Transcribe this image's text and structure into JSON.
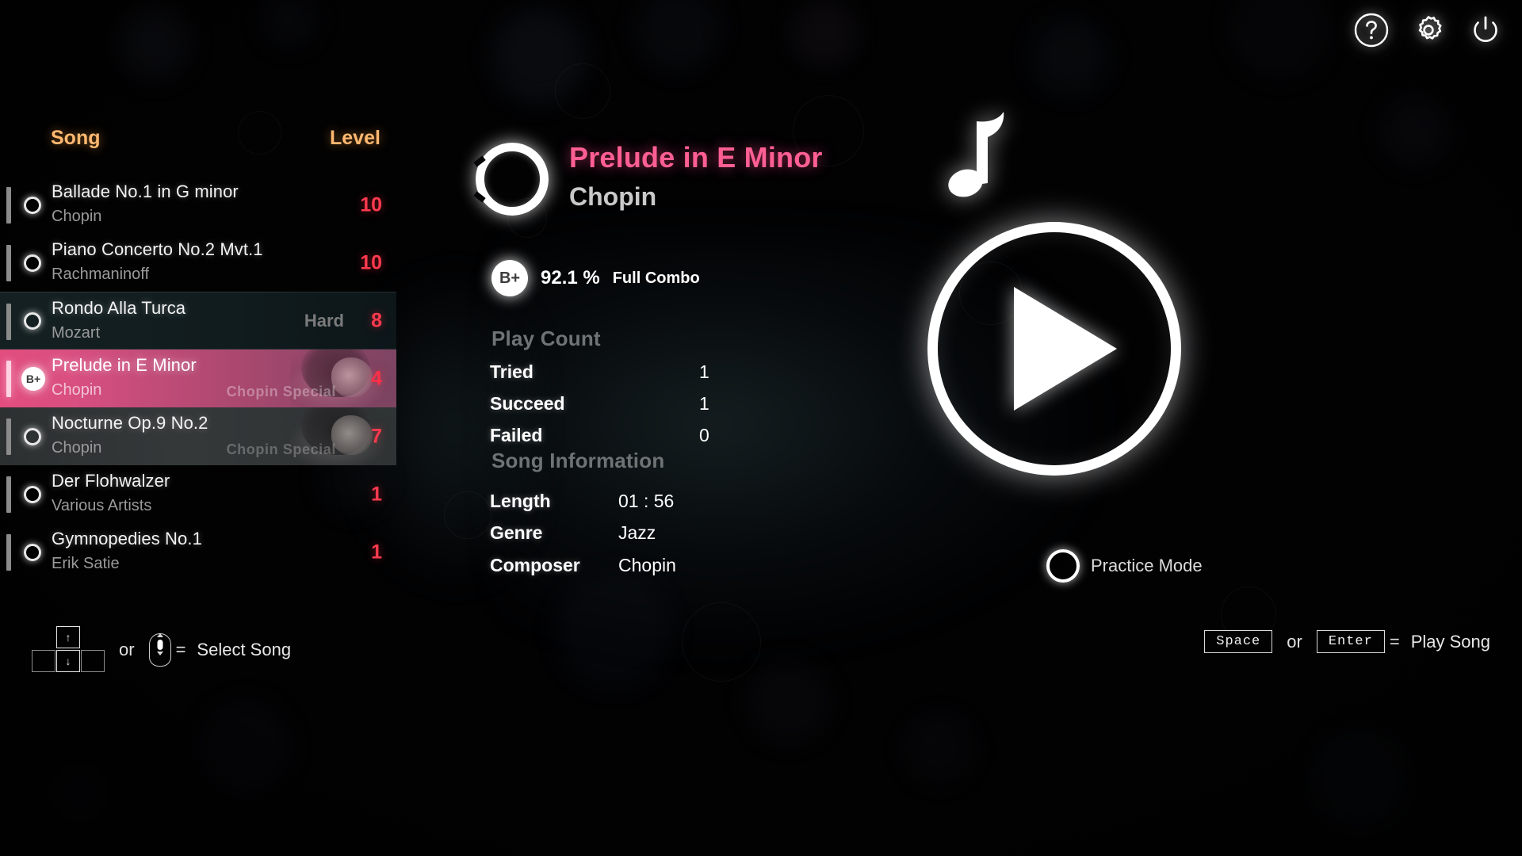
{
  "topbar": {
    "help_icon": "question-mark-icon",
    "settings_icon": "gear-icon",
    "power_icon": "power-icon"
  },
  "list": {
    "header": {
      "song": "Song",
      "level": "Level"
    },
    "rows": [
      {
        "title": "Ballade No.1 in G minor",
        "artist": "Chopin",
        "level": "10",
        "difficulty": "",
        "special": "",
        "grade": "",
        "state": "plain"
      },
      {
        "title": "Piano Concerto No.2 Mvt.1",
        "artist": "Rachmaninoff",
        "level": "10",
        "difficulty": "",
        "special": "",
        "grade": "",
        "state": "plain"
      },
      {
        "title": "Rondo Alla Turca",
        "artist": "Mozart",
        "level": "8",
        "difficulty": "Hard",
        "special": "",
        "grade": "",
        "state": "hover"
      },
      {
        "title": "Prelude in E Minor",
        "artist": "Chopin",
        "level": "4",
        "difficulty": "",
        "special": "Chopin Special",
        "grade": "B+",
        "state": "selected"
      },
      {
        "title": "Nocturne Op.9 No.2",
        "artist": "Chopin",
        "level": "7",
        "difficulty": "",
        "special": "Chopin Special",
        "grade": "",
        "state": "special"
      },
      {
        "title": "Der Flohwalzer",
        "artist": "Various Artists",
        "level": "1",
        "difficulty": "",
        "special": "",
        "grade": "",
        "state": "plain"
      },
      {
        "title": "Gymnopedies No.1",
        "artist": "Erik Satie",
        "level": "1",
        "difficulty": "",
        "special": "",
        "grade": "",
        "state": "plain"
      }
    ]
  },
  "detail": {
    "disc_icon": "disc-icon",
    "song_title": "Prelude in E Minor",
    "composer_sub": "Chopin",
    "score": {
      "grade": "B+",
      "percent": "92.1 %",
      "combo": "Full Combo"
    },
    "play_count": {
      "heading": "Play Count",
      "rows": [
        {
          "label": "Tried",
          "value": "1"
        },
        {
          "label": "Succeed",
          "value": "1"
        },
        {
          "label": "Failed",
          "value": "0"
        }
      ]
    },
    "song_information": {
      "heading": "Song Information",
      "rows": [
        {
          "label": "Length",
          "value": "01 : 56"
        },
        {
          "label": "Genre",
          "value": "Jazz"
        },
        {
          "label": "Composer",
          "value": "Chopin"
        }
      ]
    }
  },
  "right": {
    "note_icon": "music-note-icon",
    "play_icon": "play-icon",
    "practice_label": "Practice Mode"
  },
  "hints": {
    "left": {
      "key_up": "↑",
      "key_down": "↓",
      "or": "or",
      "mouse_icon": "mouse-scroll-icon",
      "equals": "=",
      "action": "Select Song"
    },
    "right": {
      "key_space": "Space",
      "or": "or",
      "key_enter": "Enter",
      "equals": "=",
      "action": "Play Song"
    }
  },
  "colors": {
    "accent_orange": "#ffb870",
    "accent_pink": "#ff5f93",
    "level_red": "#ff3a4e",
    "selected_row": "#e24d7e"
  }
}
